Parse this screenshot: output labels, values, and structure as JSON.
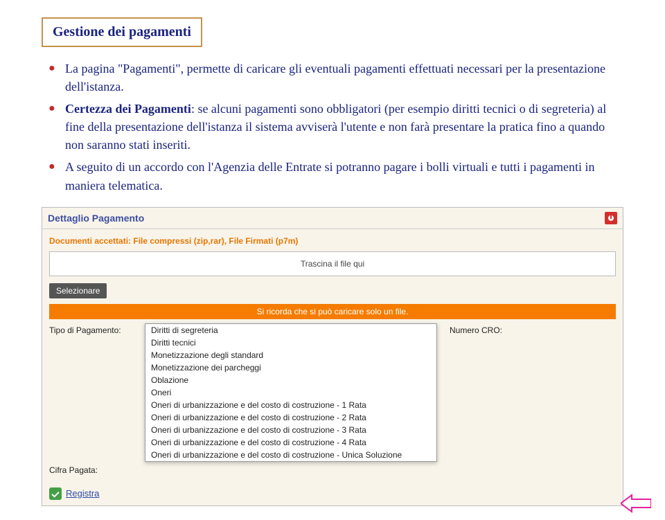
{
  "title": "Gestione dei pagamenti",
  "bullets": [
    {
      "prefix": "",
      "bold": "",
      "body": "La pagina \"Pagamenti\", permette di caricare gli eventuali pagamenti effettuati necessari per la presentazione dell'istanza."
    },
    {
      "prefix": "",
      "bold": "Certezza dei Pagamenti",
      "body": ": se alcuni pagamenti sono obbligatori (per esempio diritti tecnici o di segreteria) al fine della presentazione dell'istanza il sistema avviserà l'utente e non farà presentare la pratica fino a quando non saranno stati inseriti."
    },
    {
      "prefix": "",
      "bold": "",
      "body": "A seguito di un accordo con l'Agenzia delle Entrate si potranno pagare i bolli virtuali e tutti i pagamenti in maniera telematica."
    }
  ],
  "panel": {
    "title": "Dettaglio Pagamento",
    "docs_accepted": "Documenti accettati: File compressi (zip,rar), File Firmati (p7m)",
    "dropzone": "Trascina il file qui",
    "select_label": "Selezionare",
    "orange_notice": "Si ricorda che si può caricare solo un file.",
    "tipo_label": "Tipo di Pagamento:",
    "cifra_label": "Cifra Pagata:",
    "numero_cro_label": "Numero CRO:",
    "registra_label": "Registra",
    "options": [
      "Diritti di segreteria",
      "Diritti tecnici",
      "Monetizzazione degli standard",
      "Monetizzazione dei parcheggi",
      "Oblazione",
      "Oneri",
      "Oneri di urbanizzazione e del costo di costruzione - 1 Rata",
      "Oneri di urbanizzazione e del costo di costruzione - 2 Rata",
      "Oneri di urbanizzazione e del costo di costruzione - 3 Rata",
      "Oneri di urbanizzazione e del costo di costruzione - 4 Rata",
      "Oneri di urbanizzazione e del costo di costruzione - Unica Soluzione"
    ]
  }
}
